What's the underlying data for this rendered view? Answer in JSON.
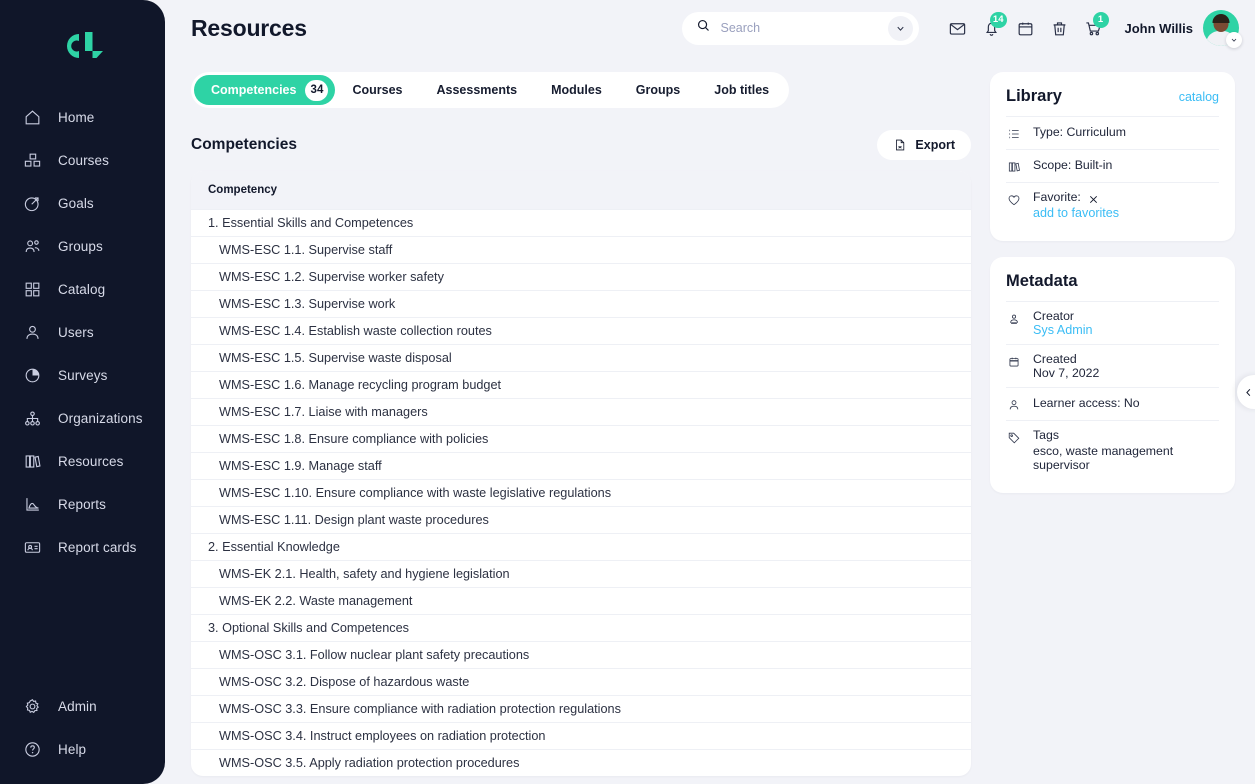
{
  "brand": {
    "logo_name": "cl-logo",
    "accent": "#2ed3a5",
    "sidebar_bg": "#101629",
    "page_bg": "#f2f3f8",
    "link_blue": "#3bbdf5"
  },
  "sidebar": {
    "items": [
      {
        "label": "Home",
        "icon": "home-icon"
      },
      {
        "label": "Courses",
        "icon": "cubes-icon"
      },
      {
        "label": "Goals",
        "icon": "target-icon"
      },
      {
        "label": "Groups",
        "icon": "people-icon"
      },
      {
        "label": "Catalog",
        "icon": "grid-icon"
      },
      {
        "label": "Users",
        "icon": "user-icon"
      },
      {
        "label": "Surveys",
        "icon": "pie-chart-icon"
      },
      {
        "label": "Organizations",
        "icon": "org-tree-icon"
      },
      {
        "label": "Resources",
        "icon": "books-icon"
      },
      {
        "label": "Reports",
        "icon": "chart-icon"
      },
      {
        "label": "Report cards",
        "icon": "id-card-icon"
      }
    ],
    "bottom_items": [
      {
        "label": "Admin",
        "icon": "gear-icon"
      },
      {
        "label": "Help",
        "icon": "question-circle-icon"
      }
    ]
  },
  "header": {
    "title": "Resources",
    "search": {
      "placeholder": "Search",
      "value": ""
    },
    "icons": [
      {
        "name": "mail-icon",
        "badge": ""
      },
      {
        "name": "bell-icon",
        "badge": "14"
      },
      {
        "name": "calendar-icon",
        "badge": ""
      },
      {
        "name": "trash-icon",
        "badge": ""
      },
      {
        "name": "cart-icon",
        "badge": "1"
      }
    ],
    "username": "John Willis"
  },
  "tabs": [
    {
      "label": "Competencies",
      "count": "34",
      "active": true
    },
    {
      "label": "Courses",
      "count": "",
      "active": false
    },
    {
      "label": "Assessments",
      "count": "",
      "active": false
    },
    {
      "label": "Modules",
      "count": "",
      "active": false
    },
    {
      "label": "Groups",
      "count": "",
      "active": false
    },
    {
      "label": "Job titles",
      "count": "",
      "active": false
    }
  ],
  "section": {
    "title": "Competencies",
    "export_label": "Export"
  },
  "table": {
    "column_header": "Competency",
    "rows": [
      {
        "text": "1. Essential Skills and Competences",
        "level": "group"
      },
      {
        "text": "WMS-ESC 1.1. Supervise staff",
        "level": "child"
      },
      {
        "text": "WMS-ESC 1.2. Supervise worker safety",
        "level": "child"
      },
      {
        "text": "WMS-ESC 1.3. Supervise work",
        "level": "child"
      },
      {
        "text": "WMS-ESC 1.4. Establish waste collection routes",
        "level": "child"
      },
      {
        "text": "WMS-ESC 1.5. Supervise waste disposal",
        "level": "child"
      },
      {
        "text": "WMS-ESC 1.6. Manage recycling program budget",
        "level": "child"
      },
      {
        "text": "WMS-ESC 1.7. Liaise with managers",
        "level": "child"
      },
      {
        "text": "WMS-ESC 1.8. Ensure compliance with policies",
        "level": "child"
      },
      {
        "text": "WMS-ESC 1.9. Manage staff",
        "level": "child"
      },
      {
        "text": "WMS-ESC 1.10. Ensure compliance with waste legislative regulations",
        "level": "child"
      },
      {
        "text": "WMS-ESC 1.11. Design plant waste procedures",
        "level": "child"
      },
      {
        "text": "2. Essential Knowledge",
        "level": "group"
      },
      {
        "text": "WMS-EK 2.1. Health, safety and hygiene legislation",
        "level": "child"
      },
      {
        "text": "WMS-EK 2.2. Waste management",
        "level": "child"
      },
      {
        "text": "3. Optional Skills and Competences",
        "level": "group"
      },
      {
        "text": "WMS-OSC 3.1. Follow nuclear plant safety precautions",
        "level": "child"
      },
      {
        "text": "WMS-OSC 3.2. Dispose of hazardous waste",
        "level": "child"
      },
      {
        "text": "WMS-OSC 3.3. Ensure compliance with radiation protection regulations",
        "level": "child"
      },
      {
        "text": "WMS-OSC 3.4. Instruct employees on radiation protection",
        "level": "child"
      },
      {
        "text": "WMS-OSC 3.5. Apply radiation protection procedures",
        "level": "child"
      }
    ]
  },
  "library": {
    "title": "Library",
    "link": "catalog",
    "type": "Type: Curriculum",
    "scope": "Scope: Built-in",
    "favorite_label": "Favorite:",
    "favorite_value": "✕",
    "add_favorites": "add to favorites"
  },
  "metadata": {
    "title": "Metadata",
    "creator_label": "Creator",
    "creator_value": "Sys Admin",
    "created_label": "Created",
    "created_value": "Nov 7, 2022",
    "learner_access": "Learner access: No",
    "tags_label": "Tags",
    "tags_value": "esco, waste management supervisor"
  }
}
